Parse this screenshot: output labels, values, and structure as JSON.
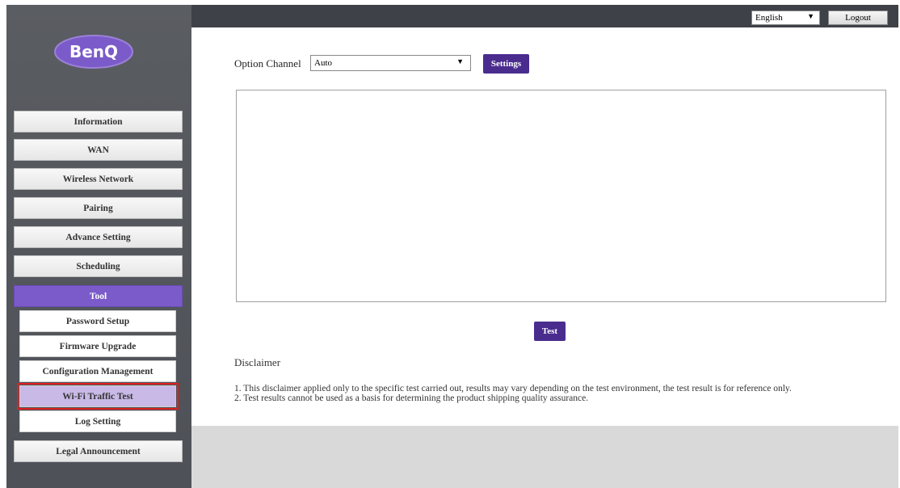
{
  "brand": {
    "logo_text": "BenQ"
  },
  "header": {
    "language": "English",
    "logout_label": "Logout"
  },
  "sidebar": {
    "items": [
      {
        "label": "Information"
      },
      {
        "label": "WAN"
      },
      {
        "label": "Wireless Network"
      },
      {
        "label": "Pairing"
      },
      {
        "label": "Advance Setting"
      },
      {
        "label": "Scheduling"
      },
      {
        "label": "Tool"
      },
      {
        "label": "Legal Announcement"
      }
    ],
    "tool_subitems": [
      {
        "label": "Password Setup"
      },
      {
        "label": "Firmware Upgrade"
      },
      {
        "label": "Configuration Management"
      },
      {
        "label": "Wi-Fi Traffic Test"
      },
      {
        "label": "Log Setting"
      }
    ]
  },
  "main": {
    "option_channel_label": "Option Channel",
    "option_channel_value": "Auto",
    "settings_button": "Settings",
    "test_button": "Test",
    "disclaimer_title": "Disclaimer",
    "disclaimer_lines": [
      "1. This disclaimer applied only to the specific test carried out, results may vary depending on the test environment, the test result is for reference only.",
      "2. Test results cannot be used as a basis for determining the product shipping quality assurance."
    ]
  },
  "colors": {
    "accent_purple": "#4a2c8f",
    "active_nav": "#7b5bc9",
    "selected_sub": "#c9b9e6",
    "highlight_border": "#e02020"
  }
}
